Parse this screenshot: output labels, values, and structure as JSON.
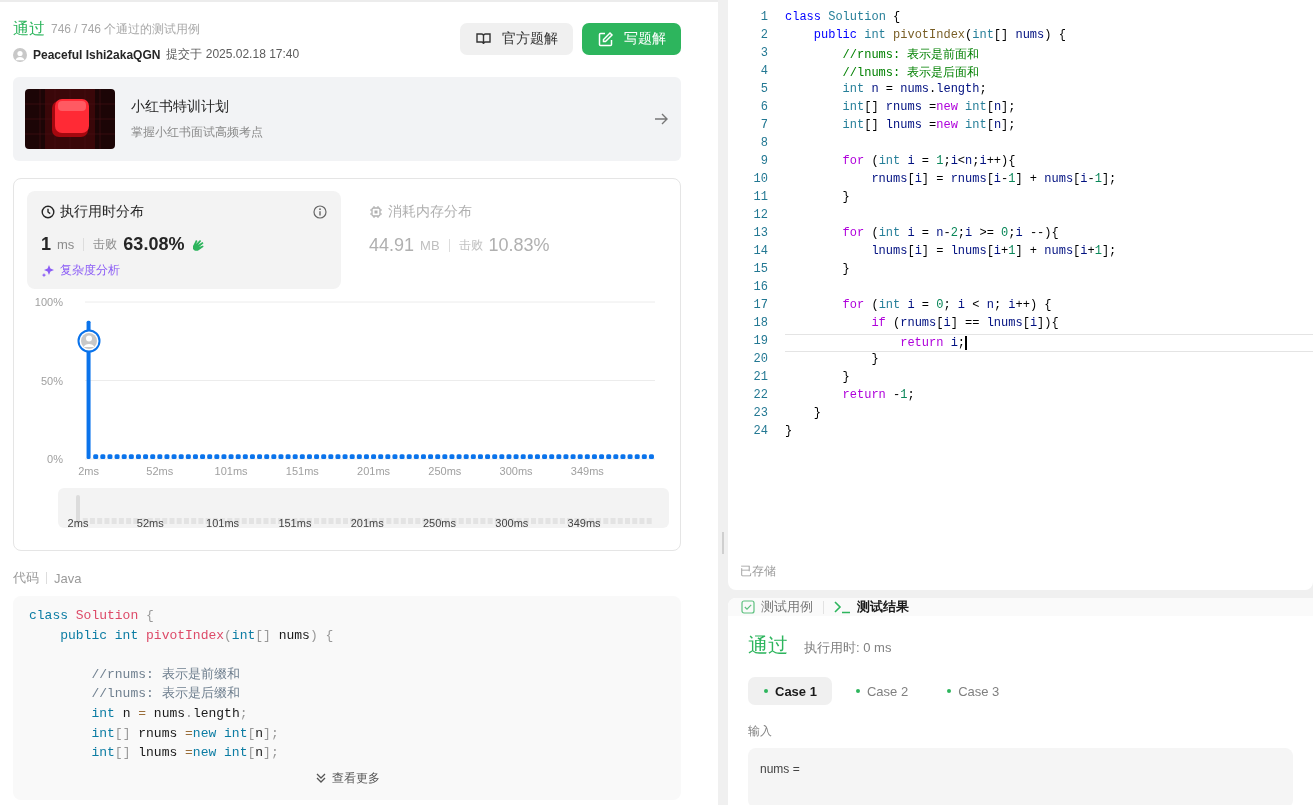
{
  "submission": {
    "status": "通过",
    "cases_passed": "746 / 746 个通过的测试用例",
    "user": "Peaceful Ishi2akaQGN",
    "submitted": "提交于 2025.02.18 17:40",
    "buttons": [
      {
        "label": "官方题解",
        "kind": "secondary"
      },
      {
        "label": "写题解",
        "kind": "primary"
      }
    ]
  },
  "promo": {
    "title": "小红书特训计划",
    "subtitle": "掌握小红书面试高频考点"
  },
  "stats": {
    "panels": [
      {
        "title": "执行用时分布",
        "value": "1",
        "unit": "ms",
        "beats_label": "击败",
        "beats": "63.08%",
        "link": "复杂度分析",
        "kind": "runtime",
        "selected": true
      },
      {
        "title": "消耗内存分布",
        "value": "44.91",
        "unit": "MB",
        "beats_label": "击败",
        "beats": "10.83%",
        "kind": "memory",
        "selected": false
      }
    ],
    "chart_data": {
      "type": "bar",
      "ylim": [
        0,
        100
      ],
      "categories": [
        "2ms",
        null,
        null,
        null,
        null,
        null,
        null,
        null,
        null,
        null,
        "52ms",
        null,
        null,
        null,
        null,
        null,
        null,
        null,
        null,
        null,
        "101ms",
        null,
        null,
        null,
        null,
        null,
        null,
        null,
        null,
        null,
        "151ms",
        null,
        null,
        null,
        null,
        null,
        null,
        null,
        null,
        null,
        "201ms",
        null,
        null,
        null,
        null,
        null,
        null,
        null,
        null,
        null,
        "250ms",
        null,
        null,
        null,
        null,
        null,
        null,
        null,
        null,
        null,
        "300ms",
        null,
        null,
        null,
        null,
        null,
        null,
        null,
        null,
        null,
        "349ms",
        null,
        null,
        null,
        null,
        null,
        null,
        null,
        null,
        null
      ],
      "values": [
        88,
        3,
        3,
        3,
        3,
        3,
        3,
        3,
        3,
        3,
        3,
        3,
        3,
        3,
        3,
        3,
        3,
        3,
        3,
        3,
        3,
        3,
        3,
        3,
        3,
        3,
        3,
        3,
        3,
        3,
        3,
        3,
        3,
        3,
        3,
        3,
        3,
        3,
        3,
        3,
        3,
        3,
        3,
        3,
        3,
        3,
        3,
        3,
        3,
        3,
        3,
        3,
        3,
        3,
        3,
        3,
        3,
        3,
        3,
        3,
        3,
        3,
        3,
        3,
        3,
        3,
        3,
        3,
        3,
        3,
        3,
        3,
        3,
        3,
        3,
        3,
        3,
        3,
        3,
        3
      ],
      "yticks": [
        {
          "value": 0,
          "label": "0%"
        },
        {
          "value": 50,
          "label": "50%"
        },
        {
          "value": 100,
          "label": "100%"
        }
      ]
    },
    "overview": {
      "labels": [
        "2ms",
        "52ms",
        "101ms",
        "151ms",
        "201ms",
        "250ms",
        "300ms",
        "349ms"
      ]
    }
  },
  "code_preview": {
    "label": "代码",
    "language": "Java",
    "more": "查看更多",
    "lines": [
      {
        "kind": "code",
        "tokens": [
          {
            "kind": "kw",
            "text": "class "
          },
          {
            "kind": "cls",
            "text": "Solution "
          },
          {
            "kind": "p",
            "text": "{"
          }
        ]
      },
      {
        "kind": "code",
        "tokens": [
          {
            "kind": "kw",
            "text": "    public int "
          },
          {
            "kind": "cls",
            "text": "pivotIndex"
          },
          {
            "kind": "p",
            "text": "("
          },
          {
            "kind": "kw",
            "text": "int"
          },
          {
            "kind": "p",
            "text": "[]"
          },
          {
            "kind": "t",
            "text": " nums"
          },
          {
            "kind": "p",
            "text": ") {"
          }
        ]
      },
      {
        "kind": "blank"
      },
      {
        "kind": "code",
        "tokens": [
          {
            "kind": "c",
            "text": "        //rnums: 表示是前缀和"
          }
        ]
      },
      {
        "kind": "code",
        "tokens": [
          {
            "kind": "c",
            "text": "        //lnums: 表示是后缀和"
          }
        ]
      },
      {
        "kind": "code",
        "tokens": [
          {
            "kind": "kw",
            "text": "        int"
          },
          {
            "kind": "t",
            "text": " n "
          },
          {
            "kind": "o",
            "text": "="
          },
          {
            "kind": "t",
            "text": " nums"
          },
          {
            "kind": "p",
            "text": "."
          },
          {
            "kind": "t",
            "text": "length"
          },
          {
            "kind": "p",
            "text": ";"
          }
        ]
      },
      {
        "kind": "code",
        "tokens": [
          {
            "kind": "kw",
            "text": "        int"
          },
          {
            "kind": "p",
            "text": "[]"
          },
          {
            "kind": "t",
            "text": " rnums "
          },
          {
            "kind": "o",
            "text": "="
          },
          {
            "kind": "kw",
            "text": "new int"
          },
          {
            "kind": "p",
            "text": "["
          },
          {
            "kind": "t",
            "text": "n"
          },
          {
            "kind": "p",
            "text": "];"
          }
        ]
      },
      {
        "kind": "code",
        "tokens": [
          {
            "kind": "kw",
            "text": "        int"
          },
          {
            "kind": "p",
            "text": "[]"
          },
          {
            "kind": "t",
            "text": " lnums "
          },
          {
            "kind": "o",
            "text": "="
          },
          {
            "kind": "kw",
            "text": "new int"
          },
          {
            "kind": "p",
            "text": "["
          },
          {
            "kind": "t",
            "text": "n"
          },
          {
            "kind": "p",
            "text": "];"
          }
        ]
      }
    ]
  },
  "editor": {
    "status": "已存储",
    "lines": [
      {
        "number": "1",
        "current": false,
        "tokens": [
          {
            "kind": "kw",
            "text": "class "
          },
          {
            "kind": "ty",
            "text": "Solution"
          },
          {
            "kind": "p",
            "text": " {"
          }
        ]
      },
      {
        "number": "2",
        "current": false,
        "tokens": [
          {
            "kind": "kw",
            "text": "    public "
          },
          {
            "kind": "ty",
            "text": "int "
          },
          {
            "kind": "fn",
            "text": "pivotIndex"
          },
          {
            "kind": "p",
            "text": "("
          },
          {
            "kind": "ty",
            "text": "int"
          },
          {
            "kind": "p",
            "text": "[] "
          },
          {
            "kind": "v",
            "text": "nums"
          },
          {
            "kind": "p",
            "text": ") {"
          }
        ]
      },
      {
        "number": "3",
        "current": false,
        "tokens": [
          {
            "kind": "c",
            "text": "        //rnums: 表示是前面和"
          }
        ]
      },
      {
        "number": "4",
        "current": false,
        "tokens": [
          {
            "kind": "c",
            "text": "        //lnums: 表示是后面和"
          }
        ]
      },
      {
        "number": "5",
        "current": false,
        "tokens": [
          {
            "kind": "ty",
            "text": "        int "
          },
          {
            "kind": "v",
            "text": "n"
          },
          {
            "kind": "p",
            "text": " = "
          },
          {
            "kind": "v",
            "text": "nums"
          },
          {
            "kind": "p",
            "text": "."
          },
          {
            "kind": "v",
            "text": "length"
          },
          {
            "kind": "p",
            "text": ";"
          }
        ]
      },
      {
        "number": "6",
        "current": false,
        "tokens": [
          {
            "kind": "ty",
            "text": "        int"
          },
          {
            "kind": "p",
            "text": "[] "
          },
          {
            "kind": "v",
            "text": "rnums"
          },
          {
            "kind": "p",
            "text": " ="
          },
          {
            "kind": "ctl",
            "text": "new "
          },
          {
            "kind": "ty",
            "text": "int"
          },
          {
            "kind": "p",
            "text": "["
          },
          {
            "kind": "v",
            "text": "n"
          },
          {
            "kind": "p",
            "text": "];"
          }
        ]
      },
      {
        "number": "7",
        "current": false,
        "tokens": [
          {
            "kind": "ty",
            "text": "        int"
          },
          {
            "kind": "p",
            "text": "[] "
          },
          {
            "kind": "v",
            "text": "lnums"
          },
          {
            "kind": "p",
            "text": " ="
          },
          {
            "kind": "ctl",
            "text": "new "
          },
          {
            "kind": "ty",
            "text": "int"
          },
          {
            "kind": "p",
            "text": "["
          },
          {
            "kind": "v",
            "text": "n"
          },
          {
            "kind": "p",
            "text": "];"
          }
        ]
      },
      {
        "number": "8",
        "current": false
      },
      {
        "number": "9",
        "current": false,
        "tokens": [
          {
            "kind": "ctl",
            "text": "        for"
          },
          {
            "kind": "p",
            "text": " ("
          },
          {
            "kind": "ty",
            "text": "int "
          },
          {
            "kind": "v",
            "text": "i"
          },
          {
            "kind": "p",
            "text": " = "
          },
          {
            "kind": "n",
            "text": "1"
          },
          {
            "kind": "p",
            "text": ";"
          },
          {
            "kind": "v",
            "text": "i"
          },
          {
            "kind": "p",
            "text": "<"
          },
          {
            "kind": "v",
            "text": "n"
          },
          {
            "kind": "p",
            "text": ";"
          },
          {
            "kind": "v",
            "text": "i"
          },
          {
            "kind": "p",
            "text": "++){"
          }
        ]
      },
      {
        "number": "10",
        "current": false,
        "tokens": [
          {
            "kind": "v",
            "text": "            rnums"
          },
          {
            "kind": "p",
            "text": "["
          },
          {
            "kind": "v",
            "text": "i"
          },
          {
            "kind": "p",
            "text": "] = "
          },
          {
            "kind": "v",
            "text": "rnums"
          },
          {
            "kind": "p",
            "text": "["
          },
          {
            "kind": "v",
            "text": "i"
          },
          {
            "kind": "p",
            "text": "-"
          },
          {
            "kind": "n",
            "text": "1"
          },
          {
            "kind": "p",
            "text": "] + "
          },
          {
            "kind": "v",
            "text": "nums"
          },
          {
            "kind": "p",
            "text": "["
          },
          {
            "kind": "v",
            "text": "i"
          },
          {
            "kind": "p",
            "text": "-"
          },
          {
            "kind": "n",
            "text": "1"
          },
          {
            "kind": "p",
            "text": "];"
          }
        ]
      },
      {
        "number": "11",
        "current": false,
        "tokens": [
          {
            "kind": "p",
            "text": "        }"
          }
        ]
      },
      {
        "number": "12",
        "current": false
      },
      {
        "number": "13",
        "current": false,
        "tokens": [
          {
            "kind": "ctl",
            "text": "        for"
          },
          {
            "kind": "p",
            "text": " ("
          },
          {
            "kind": "ty",
            "text": "int "
          },
          {
            "kind": "v",
            "text": "i"
          },
          {
            "kind": "p",
            "text": " = "
          },
          {
            "kind": "v",
            "text": "n"
          },
          {
            "kind": "p",
            "text": "-"
          },
          {
            "kind": "n",
            "text": "2"
          },
          {
            "kind": "p",
            "text": ";"
          },
          {
            "kind": "v",
            "text": "i"
          },
          {
            "kind": "p",
            "text": " >= "
          },
          {
            "kind": "n",
            "text": "0"
          },
          {
            "kind": "p",
            "text": ";"
          },
          {
            "kind": "v",
            "text": "i"
          },
          {
            "kind": "p",
            "text": " --){"
          }
        ]
      },
      {
        "number": "14",
        "current": false,
        "tokens": [
          {
            "kind": "v",
            "text": "            lnums"
          },
          {
            "kind": "p",
            "text": "["
          },
          {
            "kind": "v",
            "text": "i"
          },
          {
            "kind": "p",
            "text": "] = "
          },
          {
            "kind": "v",
            "text": "lnums"
          },
          {
            "kind": "p",
            "text": "["
          },
          {
            "kind": "v",
            "text": "i"
          },
          {
            "kind": "p",
            "text": "+"
          },
          {
            "kind": "n",
            "text": "1"
          },
          {
            "kind": "p",
            "text": "] + "
          },
          {
            "kind": "v",
            "text": "nums"
          },
          {
            "kind": "p",
            "text": "["
          },
          {
            "kind": "v",
            "text": "i"
          },
          {
            "kind": "p",
            "text": "+"
          },
          {
            "kind": "n",
            "text": "1"
          },
          {
            "kind": "p",
            "text": "];"
          }
        ]
      },
      {
        "number": "15",
        "current": false,
        "tokens": [
          {
            "kind": "p",
            "text": "        }"
          }
        ]
      },
      {
        "number": "16",
        "current": false
      },
      {
        "number": "17",
        "current": false,
        "tokens": [
          {
            "kind": "ctl",
            "text": "        for"
          },
          {
            "kind": "p",
            "text": " ("
          },
          {
            "kind": "ty",
            "text": "int "
          },
          {
            "kind": "v",
            "text": "i"
          },
          {
            "kind": "p",
            "text": " = "
          },
          {
            "kind": "n",
            "text": "0"
          },
          {
            "kind": "p",
            "text": "; "
          },
          {
            "kind": "v",
            "text": "i"
          },
          {
            "kind": "p",
            "text": " < "
          },
          {
            "kind": "v",
            "text": "n"
          },
          {
            "kind": "p",
            "text": "; "
          },
          {
            "kind": "v",
            "text": "i"
          },
          {
            "kind": "p",
            "text": "++) {"
          }
        ]
      },
      {
        "number": "18",
        "current": false,
        "tokens": [
          {
            "kind": "ctl",
            "text": "            if"
          },
          {
            "kind": "p",
            "text": " ("
          },
          {
            "kind": "v",
            "text": "rnums"
          },
          {
            "kind": "p",
            "text": "["
          },
          {
            "kind": "v",
            "text": "i"
          },
          {
            "kind": "p",
            "text": "] == "
          },
          {
            "kind": "v",
            "text": "lnums"
          },
          {
            "kind": "p",
            "text": "["
          },
          {
            "kind": "v",
            "text": "i"
          },
          {
            "kind": "p",
            "text": "]){"
          }
        ]
      },
      {
        "number": "19",
        "current": true,
        "tokens": [
          {
            "kind": "ctl",
            "text": "                return "
          },
          {
            "kind": "v",
            "text": "i"
          },
          {
            "kind": "p",
            "text": ";"
          }
        ]
      },
      {
        "number": "20",
        "current": false,
        "tokens": [
          {
            "kind": "p",
            "text": "            }"
          }
        ]
      },
      {
        "number": "21",
        "current": false,
        "tokens": [
          {
            "kind": "p",
            "text": "        }"
          }
        ]
      },
      {
        "number": "22",
        "current": false,
        "tokens": [
          {
            "kind": "ctl",
            "text": "        return"
          },
          {
            "kind": "p",
            "text": " -"
          },
          {
            "kind": "n",
            "text": "1"
          },
          {
            "kind": "p",
            "text": ";"
          }
        ]
      },
      {
        "number": "23",
        "current": false,
        "tokens": [
          {
            "kind": "p",
            "text": "    }"
          }
        ]
      },
      {
        "number": "24",
        "current": false,
        "tokens": [
          {
            "kind": "p",
            "text": "}"
          }
        ]
      }
    ]
  },
  "result": {
    "tabs": [
      {
        "label": "测试用例",
        "kind": "testcase",
        "selected": false
      },
      {
        "label": "测试结果",
        "kind": "result",
        "selected": true
      }
    ],
    "status": "通过",
    "runtime": "执行用时: 0 ms",
    "cases": [
      {
        "label": "Case 1",
        "passed": true,
        "selected": true
      },
      {
        "label": "Case 2",
        "passed": true,
        "selected": false
      },
      {
        "label": "Case 3",
        "passed": true,
        "selected": false
      }
    ],
    "input_label": "输入",
    "input": "nums ="
  }
}
